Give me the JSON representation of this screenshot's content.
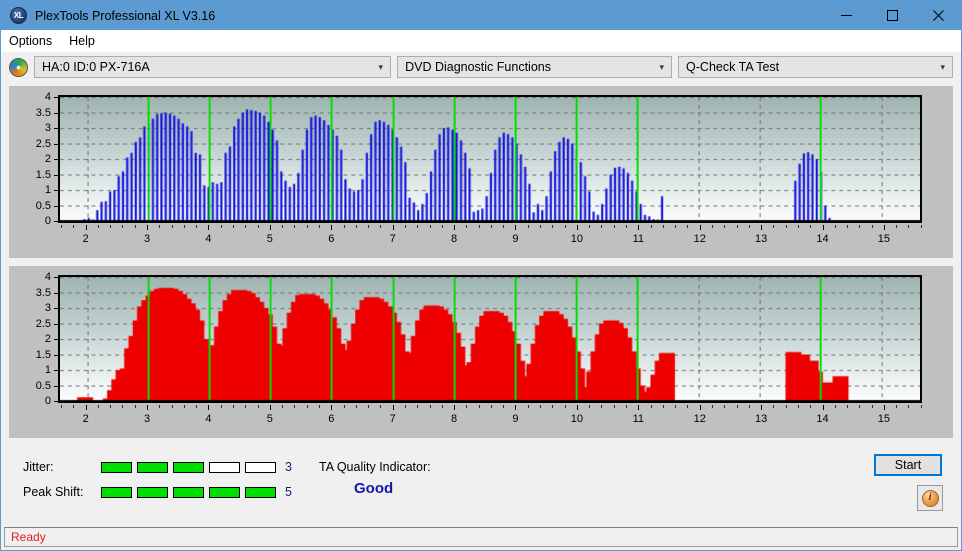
{
  "window": {
    "title": "PlexTools Professional XL V3.16",
    "app_icon": "xl-badge-icon",
    "minimize_label": "minimize-icon",
    "maximize_label": "maximize-icon",
    "close_label": "close-icon"
  },
  "menu": {
    "items": [
      {
        "label": "Options"
      },
      {
        "label": "Help"
      }
    ]
  },
  "toolbar": {
    "drive_icon": "disc-icon",
    "drive_select": "HA:0 ID:0  PX-716A",
    "function_select": "DVD Diagnostic Functions",
    "test_select": "Q-Check TA Test",
    "chevron": "⌄"
  },
  "indicators": {
    "jitter_label": "Jitter:",
    "jitter_value": "3",
    "jitter_filled": 3,
    "jitter_total": 5,
    "peak_shift_label": "Peak Shift:",
    "peak_shift_value": "5",
    "peak_shift_filled": 5,
    "peak_shift_total": 5,
    "ta_quality_label": "TA Quality Indicator:",
    "ta_quality_value": "Good",
    "start_button": "Start",
    "info_button": "i",
    "segment_on_color": "#00e000",
    "ta_value_color": "#1616b0"
  },
  "status": {
    "text": "Ready",
    "color": "#e02020"
  },
  "chart_data": [
    {
      "type": "bar",
      "name": "jitter-chart",
      "title": "",
      "xlabel": "",
      "ylabel": "",
      "series_color": "#1414dc",
      "marker_color": "#00e000",
      "bar_edge_color": "#000080",
      "xlim": [
        1.55,
        15.62
      ],
      "ylim": [
        0,
        4
      ],
      "yticks": [
        0,
        0.5,
        1,
        1.5,
        2,
        2.5,
        3,
        3.5,
        4
      ],
      "ytick_labels": [
        "0",
        "0.5",
        "1",
        "1.5",
        "2",
        "2.5",
        "3",
        "3.5",
        "4"
      ],
      "xticks": [
        2,
        3,
        4,
        5,
        6,
        7,
        8,
        9,
        10,
        11,
        12,
        13,
        14,
        15
      ],
      "xtick_labels": [
        "2",
        "3",
        "4",
        "5",
        "6",
        "7",
        "8",
        "9",
        "10",
        "11",
        "12",
        "13",
        "14",
        "15"
      ],
      "grid": true,
      "markers_x": [
        3,
        4,
        5,
        6,
        7,
        8,
        9,
        10,
        11,
        14
      ],
      "x": [
        1.95,
        2.02,
        2.09,
        2.16,
        2.23,
        2.3,
        2.37,
        2.44,
        2.51,
        2.58,
        2.65,
        2.72,
        2.79,
        2.86,
        2.93,
        3.0,
        3.07,
        3.14,
        3.21,
        3.28,
        3.35,
        3.42,
        3.49,
        3.56,
        3.63,
        3.7,
        3.77,
        3.84,
        3.91,
        3.98,
        4.05,
        4.12,
        4.19,
        4.26,
        4.33,
        4.4,
        4.47,
        4.54,
        4.61,
        4.68,
        4.75,
        4.82,
        4.89,
        4.96,
        5.03,
        5.1,
        5.17,
        5.24,
        5.31,
        5.38,
        5.45,
        5.52,
        5.59,
        5.66,
        5.73,
        5.8,
        5.87,
        5.94,
        6.01,
        6.08,
        6.15,
        6.22,
        6.29,
        6.36,
        6.43,
        6.5,
        6.57,
        6.64,
        6.71,
        6.78,
        6.85,
        6.92,
        6.99,
        7.06,
        7.13,
        7.2,
        7.27,
        7.34,
        7.41,
        7.48,
        7.55,
        7.62,
        7.69,
        7.76,
        7.83,
        7.9,
        7.97,
        8.04,
        8.11,
        8.18,
        8.25,
        8.32,
        8.39,
        8.46,
        8.53,
        8.6,
        8.67,
        8.74,
        8.81,
        8.88,
        8.95,
        9.02,
        9.09,
        9.16,
        9.23,
        9.3,
        9.37,
        9.44,
        9.51,
        9.58,
        9.65,
        9.72,
        9.79,
        9.86,
        9.93,
        10.0,
        10.07,
        10.14,
        10.21,
        10.28,
        10.35,
        10.42,
        10.49,
        10.56,
        10.63,
        10.7,
        10.77,
        10.84,
        10.91,
        10.98,
        11.05,
        11.12,
        11.19,
        11.26,
        11.33,
        11.4,
        13.58,
        13.65,
        13.72,
        13.79,
        13.86,
        13.93,
        14.0,
        14.07,
        14.14,
        14.21
      ],
      "values": [
        0.06,
        0.1,
        0.05,
        0.35,
        0.62,
        0.64,
        0.95,
        1.0,
        1.45,
        1.6,
        2.05,
        2.2,
        2.55,
        2.7,
        3.05,
        3.15,
        3.3,
        3.45,
        3.48,
        3.5,
        3.46,
        3.4,
        3.3,
        3.15,
        3.05,
        2.9,
        2.2,
        2.15,
        1.15,
        1.1,
        1.25,
        1.2,
        1.25,
        2.2,
        2.4,
        3.05,
        3.3,
        3.5,
        3.6,
        3.58,
        3.55,
        3.5,
        3.4,
        3.2,
        2.95,
        2.6,
        1.6,
        1.3,
        1.1,
        1.2,
        1.55,
        2.3,
        2.95,
        3.35,
        3.4,
        3.35,
        3.25,
        3.1,
        2.95,
        2.75,
        2.3,
        1.35,
        1.05,
        0.95,
        1.0,
        1.35,
        2.2,
        2.8,
        3.2,
        3.25,
        3.2,
        3.1,
        2.95,
        2.7,
        2.4,
        1.9,
        0.75,
        0.6,
        0.35,
        0.55,
        0.9,
        1.6,
        2.3,
        2.8,
        3.0,
        3.02,
        2.95,
        2.85,
        2.6,
        2.2,
        1.7,
        0.3,
        0.35,
        0.4,
        0.8,
        1.55,
        2.3,
        2.7,
        2.85,
        2.8,
        2.7,
        2.5,
        2.15,
        1.75,
        1.2,
        0.28,
        0.55,
        0.35,
        0.8,
        1.6,
        2.25,
        2.55,
        2.7,
        2.65,
        2.5,
        2.3,
        1.9,
        1.45,
        0.95,
        0.3,
        0.2,
        0.55,
        1.05,
        1.5,
        1.72,
        1.75,
        1.7,
        1.55,
        1.3,
        0.95,
        0.55,
        0.2,
        0.15,
        0.06,
        0.05,
        0.8,
        1.3,
        1.85,
        2.18,
        2.22,
        2.15,
        2.0,
        1.6,
        0.5,
        0.1
      ]
    },
    {
      "type": "bar",
      "name": "peak-shift-chart",
      "title": "",
      "xlabel": "",
      "ylabel": "",
      "series_color": "#ee0000",
      "marker_color": "#00e000",
      "bar_edge_color": "#800000",
      "xlim": [
        1.55,
        15.62
      ],
      "ylim": [
        0,
        4
      ],
      "yticks": [
        0,
        0.5,
        1,
        1.5,
        2,
        2.5,
        3,
        3.5,
        4
      ],
      "ytick_labels": [
        "0",
        "0.5",
        "1",
        "1.5",
        "2",
        "2.5",
        "3",
        "3.5",
        "4"
      ],
      "xticks": [
        2,
        3,
        4,
        5,
        6,
        7,
        8,
        9,
        10,
        11,
        12,
        13,
        14,
        15
      ],
      "xtick_labels": [
        "2",
        "3",
        "4",
        "5",
        "6",
        "7",
        "8",
        "9",
        "10",
        "11",
        "12",
        "13",
        "14",
        "15"
      ],
      "grid": true,
      "markers_x": [
        3,
        4,
        5,
        6,
        7,
        8,
        9,
        10,
        11,
        14
      ],
      "x": [
        1.96,
        2.38,
        2.45,
        2.52,
        2.59,
        2.66,
        2.73,
        2.8,
        2.87,
        2.94,
        3.01,
        3.08,
        3.15,
        3.22,
        3.29,
        3.36,
        3.43,
        3.5,
        3.57,
        3.64,
        3.71,
        3.78,
        3.85,
        3.92,
        3.99,
        4.06,
        4.13,
        4.2,
        4.27,
        4.34,
        4.41,
        4.48,
        4.55,
        4.62,
        4.69,
        4.76,
        4.83,
        4.9,
        4.97,
        5.04,
        5.11,
        5.18,
        5.25,
        5.32,
        5.39,
        5.46,
        5.53,
        5.6,
        5.67,
        5.74,
        5.81,
        5.88,
        5.95,
        6.02,
        6.09,
        6.16,
        6.23,
        6.3,
        6.37,
        6.44,
        6.51,
        6.58,
        6.65,
        6.72,
        6.79,
        6.86,
        6.93,
        7.0,
        7.07,
        7.14,
        7.21,
        7.28,
        7.35,
        7.42,
        7.49,
        7.56,
        7.63,
        7.7,
        7.77,
        7.84,
        7.91,
        7.98,
        8.05,
        8.12,
        8.19,
        8.26,
        8.33,
        8.4,
        8.47,
        8.54,
        8.61,
        8.68,
        8.75,
        8.82,
        8.89,
        8.96,
        9.03,
        9.1,
        9.17,
        9.24,
        9.31,
        9.38,
        9.45,
        9.52,
        9.59,
        9.66,
        9.73,
        9.8,
        9.87,
        9.94,
        10.01,
        10.08,
        10.15,
        10.22,
        10.29,
        10.36,
        10.43,
        10.5,
        10.57,
        10.64,
        10.71,
        10.78,
        10.85,
        10.92,
        10.99,
        11.06,
        11.13,
        11.2,
        11.27,
        11.34,
        11.41,
        11.48,
        13.55,
        13.69,
        13.83,
        13.9,
        13.97,
        14.04,
        14.11,
        14.18,
        14.32
      ],
      "values": [
        0.12,
        0.08,
        0.35,
        0.7,
        1.0,
        1.05,
        1.7,
        2.1,
        2.6,
        3.05,
        3.25,
        3.4,
        3.55,
        3.62,
        3.65,
        3.62,
        3.55,
        3.45,
        3.3,
        3.15,
        2.95,
        2.6,
        2.0,
        1.75,
        1.7,
        1.65,
        1.8,
        2.4,
        2.9,
        3.25,
        3.45,
        3.58,
        3.55,
        3.48,
        3.35,
        3.2,
        3.0,
        2.8,
        2.4,
        1.85,
        1.75,
        1.65,
        1.8,
        2.35,
        2.85,
        3.2,
        3.42,
        3.45,
        3.4,
        3.3,
        3.15,
        2.95,
        2.7,
        2.35,
        1.85,
        1.65,
        1.55,
        1.6,
        1.95,
        2.5,
        2.95,
        3.25,
        3.35,
        3.3,
        3.2,
        3.05,
        2.85,
        2.55,
        2.15,
        1.6,
        1.05,
        1.25,
        1.55,
        2.1,
        2.6,
        2.95,
        3.08,
        3.05,
        2.95,
        2.8,
        2.55,
        2.2,
        1.75,
        1.15,
        0.95,
        0.9,
        1.25,
        1.85,
        2.4,
        2.75,
        2.9,
        2.85,
        2.75,
        2.55,
        2.25,
        1.85,
        1.3,
        0.8,
        0.55,
        0.7,
        1.2,
        1.85,
        2.45,
        2.75,
        2.9,
        2.8,
        2.65,
        2.4,
        2.05,
        1.6,
        1.05,
        0.45,
        0.28,
        0.4,
        0.95,
        1.6,
        2.15,
        2.5,
        2.6,
        2.52,
        2.35,
        2.05,
        1.6,
        1.05,
        0.5,
        0.2,
        0.15,
        0.3,
        0.45,
        0.85,
        1.3,
        1.55,
        1.58,
        1.5,
        1.3,
        0.95,
        0.55,
        0.18,
        0.6,
        0.15,
        0.8,
        1.1,
        1.15,
        1.15,
        0.85,
        0.25,
        0.12
      ]
    }
  ]
}
